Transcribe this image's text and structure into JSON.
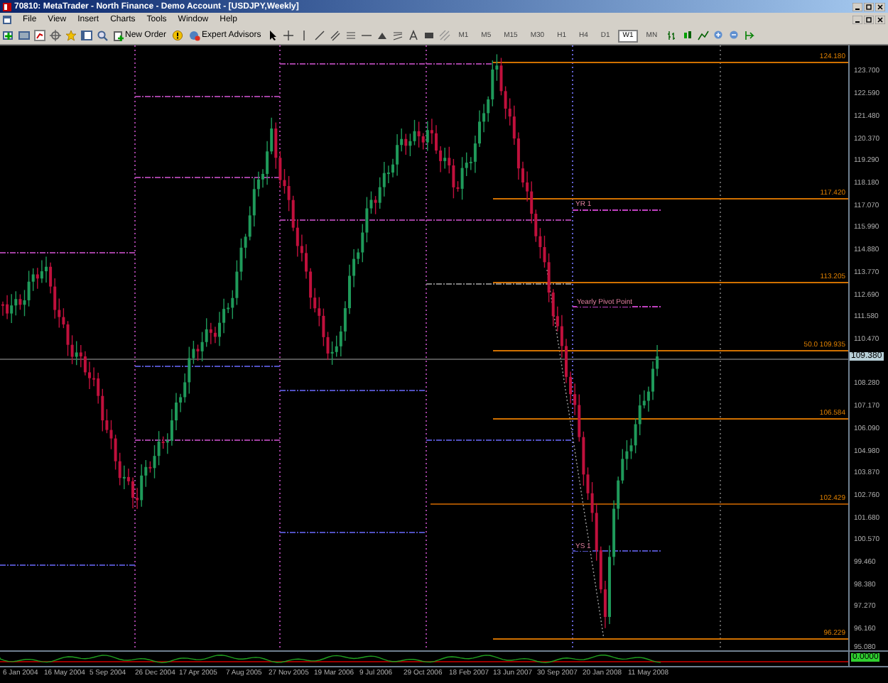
{
  "window": {
    "title": "70810: MetaTrader - North Finance - Demo Account - [USDJPY,Weekly]"
  },
  "menu": [
    "File",
    "View",
    "Insert",
    "Charts",
    "Tools",
    "Window",
    "Help"
  ],
  "toolbar": {
    "buttons": [
      "New Order",
      "Expert Advisors"
    ],
    "timeframes": [
      {
        "label": "M1",
        "selected": false
      },
      {
        "label": "M5",
        "selected": false
      },
      {
        "label": "M15",
        "selected": false
      },
      {
        "label": "M30",
        "selected": false
      },
      {
        "label": "H1",
        "selected": false
      },
      {
        "label": "H4",
        "selected": false
      },
      {
        "label": "D1",
        "selected": false
      },
      {
        "label": "W1",
        "selected": true
      },
      {
        "label": "MN",
        "selected": false
      }
    ]
  },
  "chart": {
    "fib_levels": [
      {
        "label": "124.180"
      },
      {
        "label": "117.420"
      },
      {
        "label": "113.205"
      },
      {
        "label": "50.0  109.935"
      },
      {
        "label": "106.584"
      },
      {
        "label": "102.429"
      },
      {
        "label": "96.229"
      }
    ],
    "pivot_labels": [
      "YR 1",
      "Yearly Pivot Point",
      "YS 1"
    ],
    "price_axis": [
      "123.700",
      "122.590",
      "121.480",
      "120.370",
      "119.290",
      "118.180",
      "117.070",
      "115.990",
      "114.880",
      "113.770",
      "112.690",
      "111.580",
      "110.470",
      "108.280",
      "107.170",
      "106.090",
      "104.980",
      "103.870",
      "102.760",
      "101.680",
      "100.570",
      "99.460",
      "98.380",
      "97.270",
      "96.160",
      "95.080"
    ],
    "current_price": "109.380",
    "indicator_value": "0.0000",
    "dates": [
      "6 Jan 2004",
      "16 May 2004",
      "5 Sep 2004",
      "26 Dec 2004",
      "17 Apr 2005",
      "7 Aug 2005",
      "27 Nov 2005",
      "19 Mar 2006",
      "9 Jul 2006",
      "29 Oct 2006",
      "18 Feb 2007",
      "13 Jun 2007",
      "30 Sep 2007",
      "20 Jan 2008",
      "11 May 2008"
    ]
  }
}
